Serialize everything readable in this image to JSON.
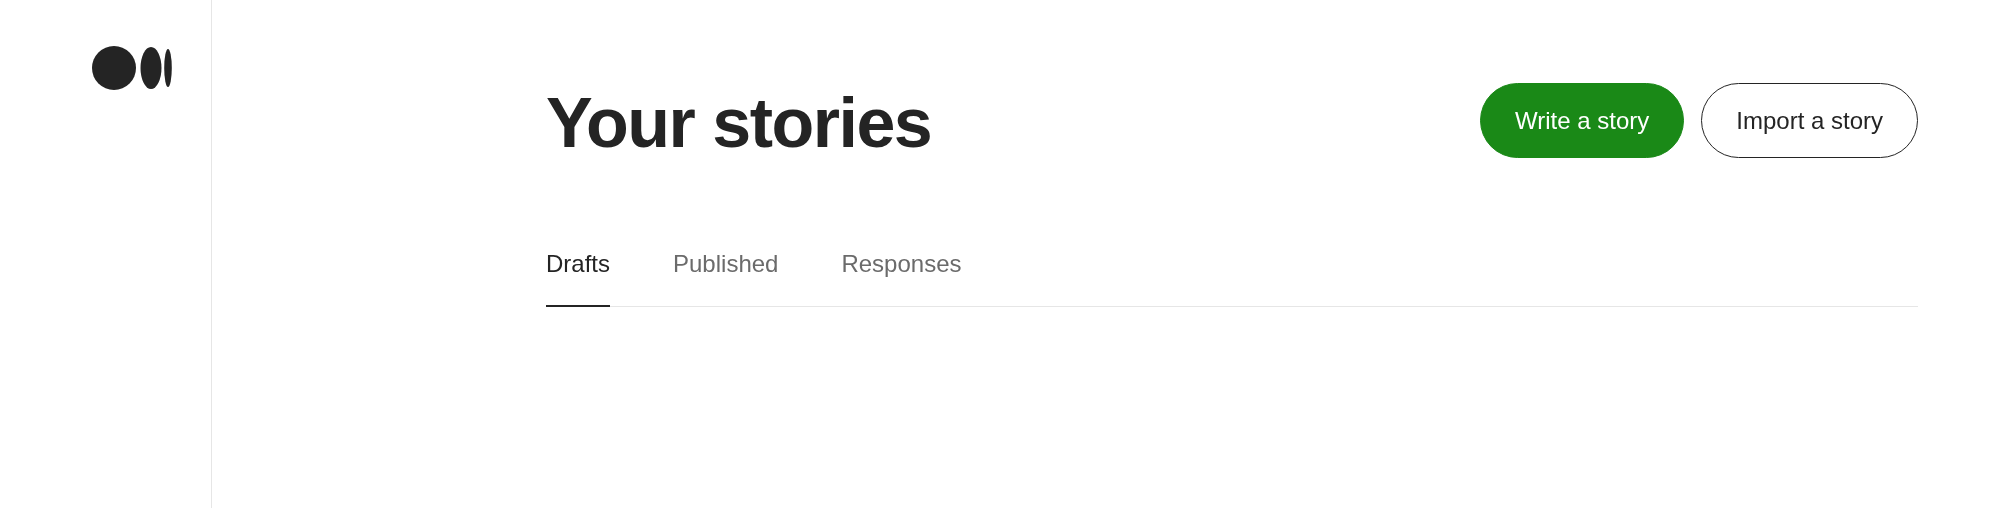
{
  "page": {
    "title": "Your stories"
  },
  "buttons": [
    {
      "label": "Write a story",
      "kind": "primary"
    },
    {
      "label": "Import a story",
      "kind": "outline"
    }
  ],
  "tabs": [
    {
      "label": "Drafts",
      "selected": true
    },
    {
      "label": "Published",
      "selected": false
    },
    {
      "label": "Responses",
      "selected": false
    }
  ]
}
